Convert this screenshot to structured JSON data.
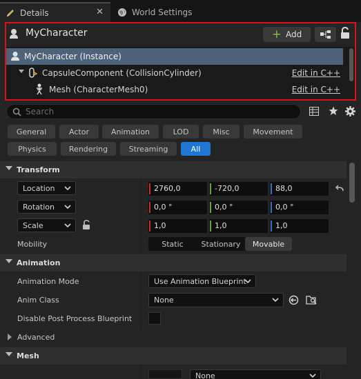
{
  "tabs": [
    {
      "label": "Details",
      "icon": "pencil-icon",
      "active": true
    },
    {
      "label": "World Settings",
      "icon": "globe-icon",
      "active": false
    }
  ],
  "header": {
    "actor_name": "MyCharacter",
    "add_label": "Add"
  },
  "tree": [
    {
      "label": "MyCharacter (Instance)",
      "selected": true,
      "edit": ""
    },
    {
      "label": "CapsuleComponent (CollisionCylinder)",
      "selected": false,
      "edit": "Edit in C++"
    },
    {
      "label": "Mesh (CharacterMesh0)",
      "selected": false,
      "edit": "Edit in C++"
    }
  ],
  "search": {
    "placeholder": "Search"
  },
  "categories": [
    "General",
    "Actor",
    "Animation",
    "LOD",
    "Misc",
    "Movement",
    "Physics",
    "Rendering",
    "Streaming",
    "All"
  ],
  "active_category": "All",
  "sections": {
    "transform": "Transform",
    "animation": "Animation",
    "advanced": "Advanced",
    "mesh": "Mesh"
  },
  "transform": {
    "location": {
      "label": "Location",
      "x": "2760,0",
      "y": "-720,0",
      "z": "88,0"
    },
    "rotation": {
      "label": "Rotation",
      "x": "0,0 °",
      "y": "0,0 °",
      "z": "0,0 °"
    },
    "scale": {
      "label": "Scale",
      "x": "1,0",
      "y": "1,0",
      "z": "1,0"
    },
    "mobility": {
      "label": "Mobility",
      "options": [
        "Static",
        "Stationary",
        "Movable"
      ],
      "selected": "Movable"
    }
  },
  "animation": {
    "mode_label": "Animation Mode",
    "mode_value": "Use Animation Blueprint",
    "class_label": "Anim Class",
    "class_value": "None",
    "dpp_label": "Disable Post Process Blueprint"
  },
  "mesh": {
    "value": "None"
  },
  "colors": {
    "x_axis": "#c4312b",
    "y_axis": "#6aa43b",
    "z_axis": "#3b6fc4",
    "accent": "#1e77d3",
    "highlight_border": "#e0101a",
    "selection": "#4e6279"
  }
}
